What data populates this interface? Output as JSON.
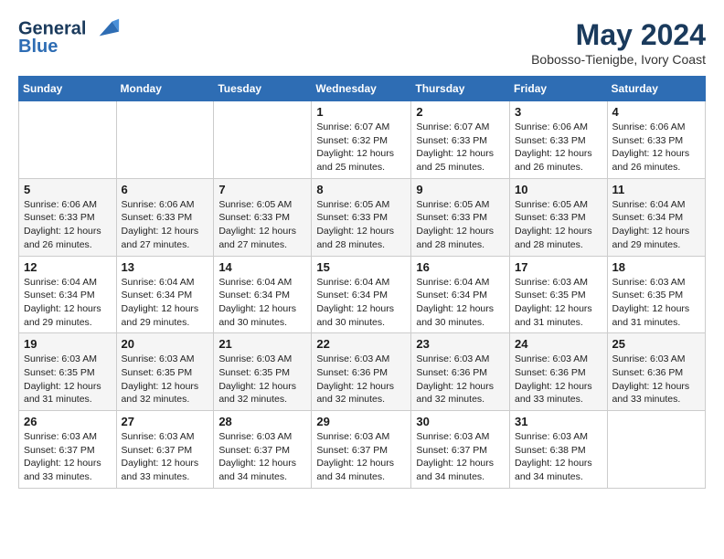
{
  "header": {
    "logo_line1": "General",
    "logo_line2": "Blue",
    "month_year": "May 2024",
    "location": "Bobosso-Tienigbe, Ivory Coast"
  },
  "weekdays": [
    "Sunday",
    "Monday",
    "Tuesday",
    "Wednesday",
    "Thursday",
    "Friday",
    "Saturday"
  ],
  "weeks": [
    [
      {
        "day": "",
        "info": ""
      },
      {
        "day": "",
        "info": ""
      },
      {
        "day": "",
        "info": ""
      },
      {
        "day": "1",
        "info": "Sunrise: 6:07 AM\nSunset: 6:32 PM\nDaylight: 12 hours\nand 25 minutes."
      },
      {
        "day": "2",
        "info": "Sunrise: 6:07 AM\nSunset: 6:33 PM\nDaylight: 12 hours\nand 25 minutes."
      },
      {
        "day": "3",
        "info": "Sunrise: 6:06 AM\nSunset: 6:33 PM\nDaylight: 12 hours\nand 26 minutes."
      },
      {
        "day": "4",
        "info": "Sunrise: 6:06 AM\nSunset: 6:33 PM\nDaylight: 12 hours\nand 26 minutes."
      }
    ],
    [
      {
        "day": "5",
        "info": "Sunrise: 6:06 AM\nSunset: 6:33 PM\nDaylight: 12 hours\nand 26 minutes."
      },
      {
        "day": "6",
        "info": "Sunrise: 6:06 AM\nSunset: 6:33 PM\nDaylight: 12 hours\nand 27 minutes."
      },
      {
        "day": "7",
        "info": "Sunrise: 6:05 AM\nSunset: 6:33 PM\nDaylight: 12 hours\nand 27 minutes."
      },
      {
        "day": "8",
        "info": "Sunrise: 6:05 AM\nSunset: 6:33 PM\nDaylight: 12 hours\nand 28 minutes."
      },
      {
        "day": "9",
        "info": "Sunrise: 6:05 AM\nSunset: 6:33 PM\nDaylight: 12 hours\nand 28 minutes."
      },
      {
        "day": "10",
        "info": "Sunrise: 6:05 AM\nSunset: 6:33 PM\nDaylight: 12 hours\nand 28 minutes."
      },
      {
        "day": "11",
        "info": "Sunrise: 6:04 AM\nSunset: 6:34 PM\nDaylight: 12 hours\nand 29 minutes."
      }
    ],
    [
      {
        "day": "12",
        "info": "Sunrise: 6:04 AM\nSunset: 6:34 PM\nDaylight: 12 hours\nand 29 minutes."
      },
      {
        "day": "13",
        "info": "Sunrise: 6:04 AM\nSunset: 6:34 PM\nDaylight: 12 hours\nand 29 minutes."
      },
      {
        "day": "14",
        "info": "Sunrise: 6:04 AM\nSunset: 6:34 PM\nDaylight: 12 hours\nand 30 minutes."
      },
      {
        "day": "15",
        "info": "Sunrise: 6:04 AM\nSunset: 6:34 PM\nDaylight: 12 hours\nand 30 minutes."
      },
      {
        "day": "16",
        "info": "Sunrise: 6:04 AM\nSunset: 6:34 PM\nDaylight: 12 hours\nand 30 minutes."
      },
      {
        "day": "17",
        "info": "Sunrise: 6:03 AM\nSunset: 6:35 PM\nDaylight: 12 hours\nand 31 minutes."
      },
      {
        "day": "18",
        "info": "Sunrise: 6:03 AM\nSunset: 6:35 PM\nDaylight: 12 hours\nand 31 minutes."
      }
    ],
    [
      {
        "day": "19",
        "info": "Sunrise: 6:03 AM\nSunset: 6:35 PM\nDaylight: 12 hours\nand 31 minutes."
      },
      {
        "day": "20",
        "info": "Sunrise: 6:03 AM\nSunset: 6:35 PM\nDaylight: 12 hours\nand 32 minutes."
      },
      {
        "day": "21",
        "info": "Sunrise: 6:03 AM\nSunset: 6:35 PM\nDaylight: 12 hours\nand 32 minutes."
      },
      {
        "day": "22",
        "info": "Sunrise: 6:03 AM\nSunset: 6:36 PM\nDaylight: 12 hours\nand 32 minutes."
      },
      {
        "day": "23",
        "info": "Sunrise: 6:03 AM\nSunset: 6:36 PM\nDaylight: 12 hours\nand 32 minutes."
      },
      {
        "day": "24",
        "info": "Sunrise: 6:03 AM\nSunset: 6:36 PM\nDaylight: 12 hours\nand 33 minutes."
      },
      {
        "day": "25",
        "info": "Sunrise: 6:03 AM\nSunset: 6:36 PM\nDaylight: 12 hours\nand 33 minutes."
      }
    ],
    [
      {
        "day": "26",
        "info": "Sunrise: 6:03 AM\nSunset: 6:37 PM\nDaylight: 12 hours\nand 33 minutes."
      },
      {
        "day": "27",
        "info": "Sunrise: 6:03 AM\nSunset: 6:37 PM\nDaylight: 12 hours\nand 33 minutes."
      },
      {
        "day": "28",
        "info": "Sunrise: 6:03 AM\nSunset: 6:37 PM\nDaylight: 12 hours\nand 34 minutes."
      },
      {
        "day": "29",
        "info": "Sunrise: 6:03 AM\nSunset: 6:37 PM\nDaylight: 12 hours\nand 34 minutes."
      },
      {
        "day": "30",
        "info": "Sunrise: 6:03 AM\nSunset: 6:37 PM\nDaylight: 12 hours\nand 34 minutes."
      },
      {
        "day": "31",
        "info": "Sunrise: 6:03 AM\nSunset: 6:38 PM\nDaylight: 12 hours\nand 34 minutes."
      },
      {
        "day": "",
        "info": ""
      }
    ]
  ]
}
